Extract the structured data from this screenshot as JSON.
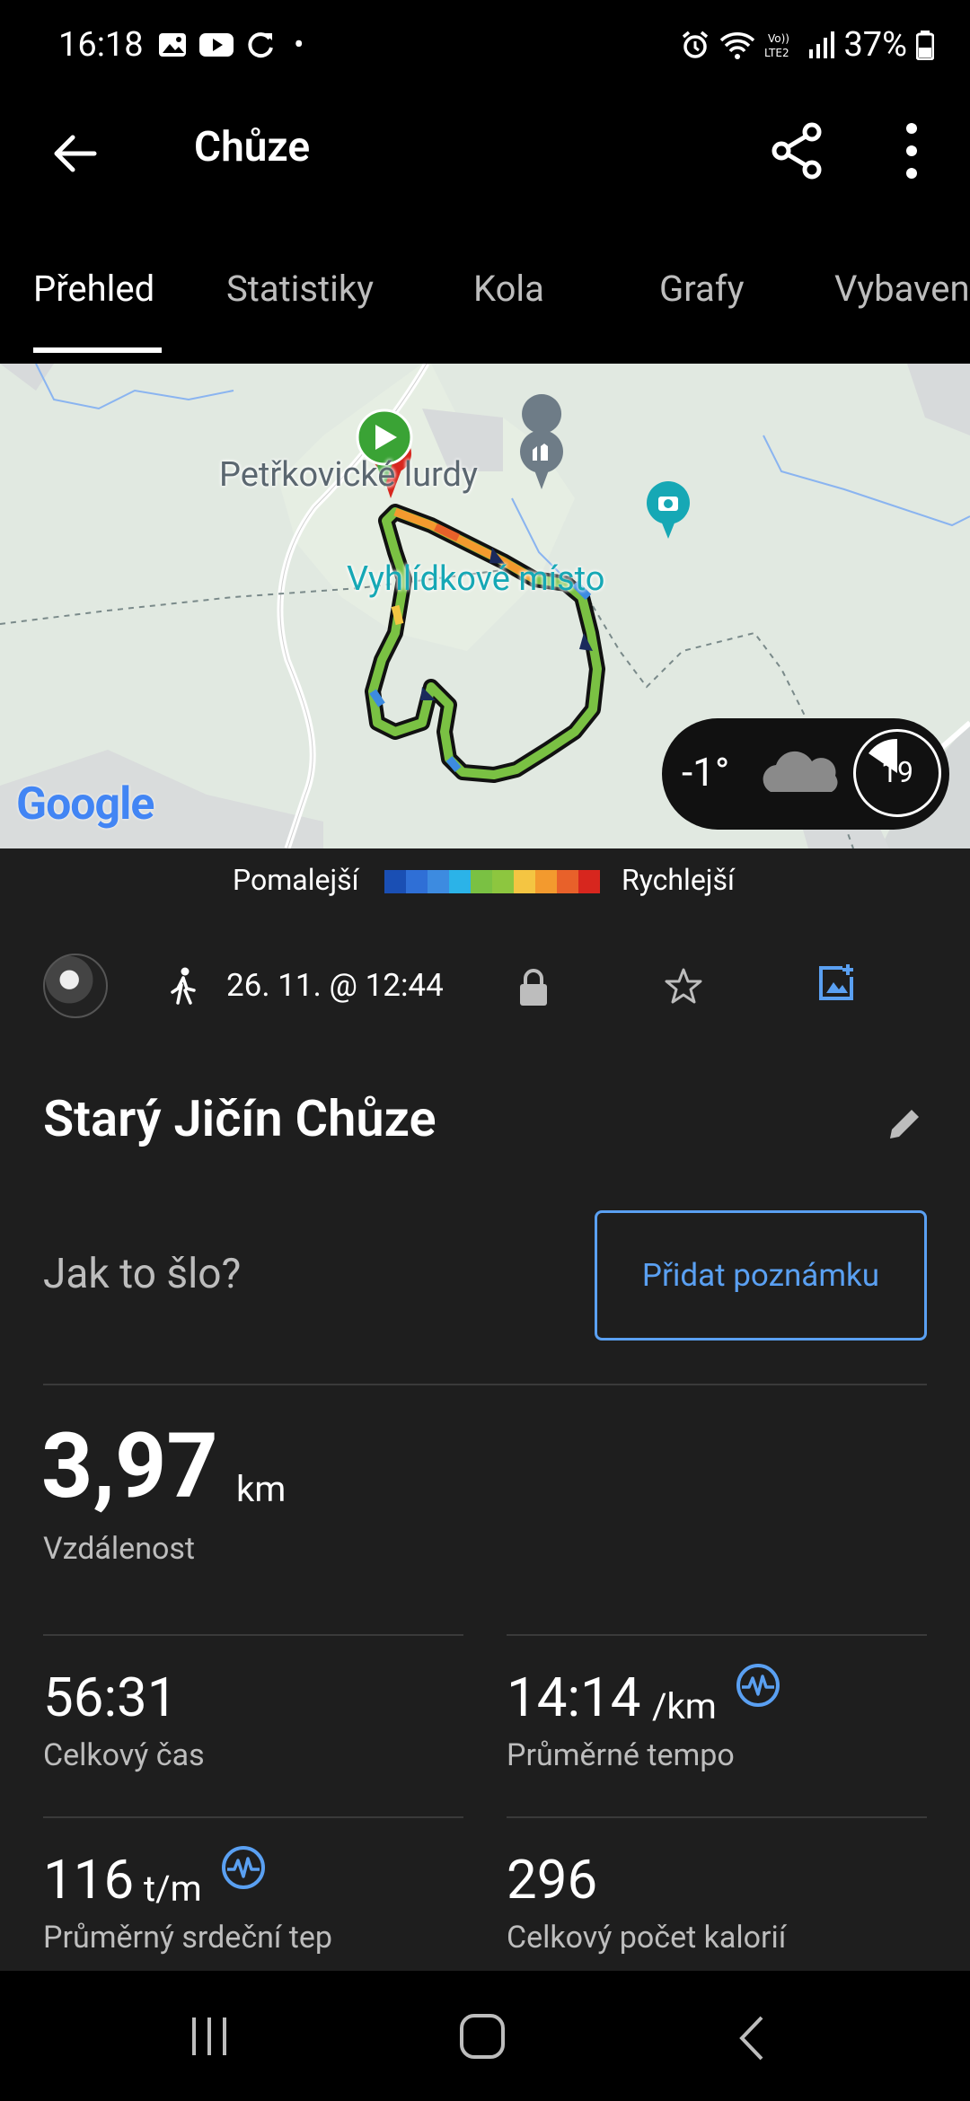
{
  "status_bar": {
    "time": "16:18",
    "battery": "37%",
    "dot": "•"
  },
  "app_bar": {
    "title": "Chůze"
  },
  "tabs": [
    {
      "label": "Přehled",
      "active": true
    },
    {
      "label": "Statistiky"
    },
    {
      "label": "Kola"
    },
    {
      "label": "Grafy"
    },
    {
      "label": "Vybaven"
    }
  ],
  "map": {
    "labels": {
      "place1": "Petřkovické lurdy",
      "place2": "Vyhlídkové místo",
      "google": "Google"
    },
    "weather": {
      "temp": "-1°",
      "moon_day": "19"
    }
  },
  "legend": {
    "slow": "Pomalejší",
    "fast": "Rychlejší",
    "colors": [
      "#1a4fb4",
      "#2f6fd6",
      "#3d8be0",
      "#2bb3e8",
      "#7ac143",
      "#8dc63f",
      "#f4c542",
      "#f39a2e",
      "#e8612a",
      "#d7261e"
    ]
  },
  "activity": {
    "date": "26. 11. @ 12:44",
    "title": "Starý Jičín Chůze"
  },
  "feeling": {
    "prompt": "Jak to šlo?",
    "button": "Přidat poznámku"
  },
  "distance": {
    "value": "3,97",
    "unit": "km",
    "label": "Vzdálenost"
  },
  "stats": {
    "total_time": {
      "value": "56:31",
      "label": "Celkový čas"
    },
    "avg_pace": {
      "value": "14:14",
      "unit": "/km",
      "label": "Průměrné tempo"
    },
    "avg_hr": {
      "value": "116",
      "unit": "t/m",
      "label": "Průměrný srdeční tep"
    },
    "calories": {
      "value": "296",
      "label": "Celkový počet kalorií"
    }
  },
  "accent": "#5aa0f2"
}
